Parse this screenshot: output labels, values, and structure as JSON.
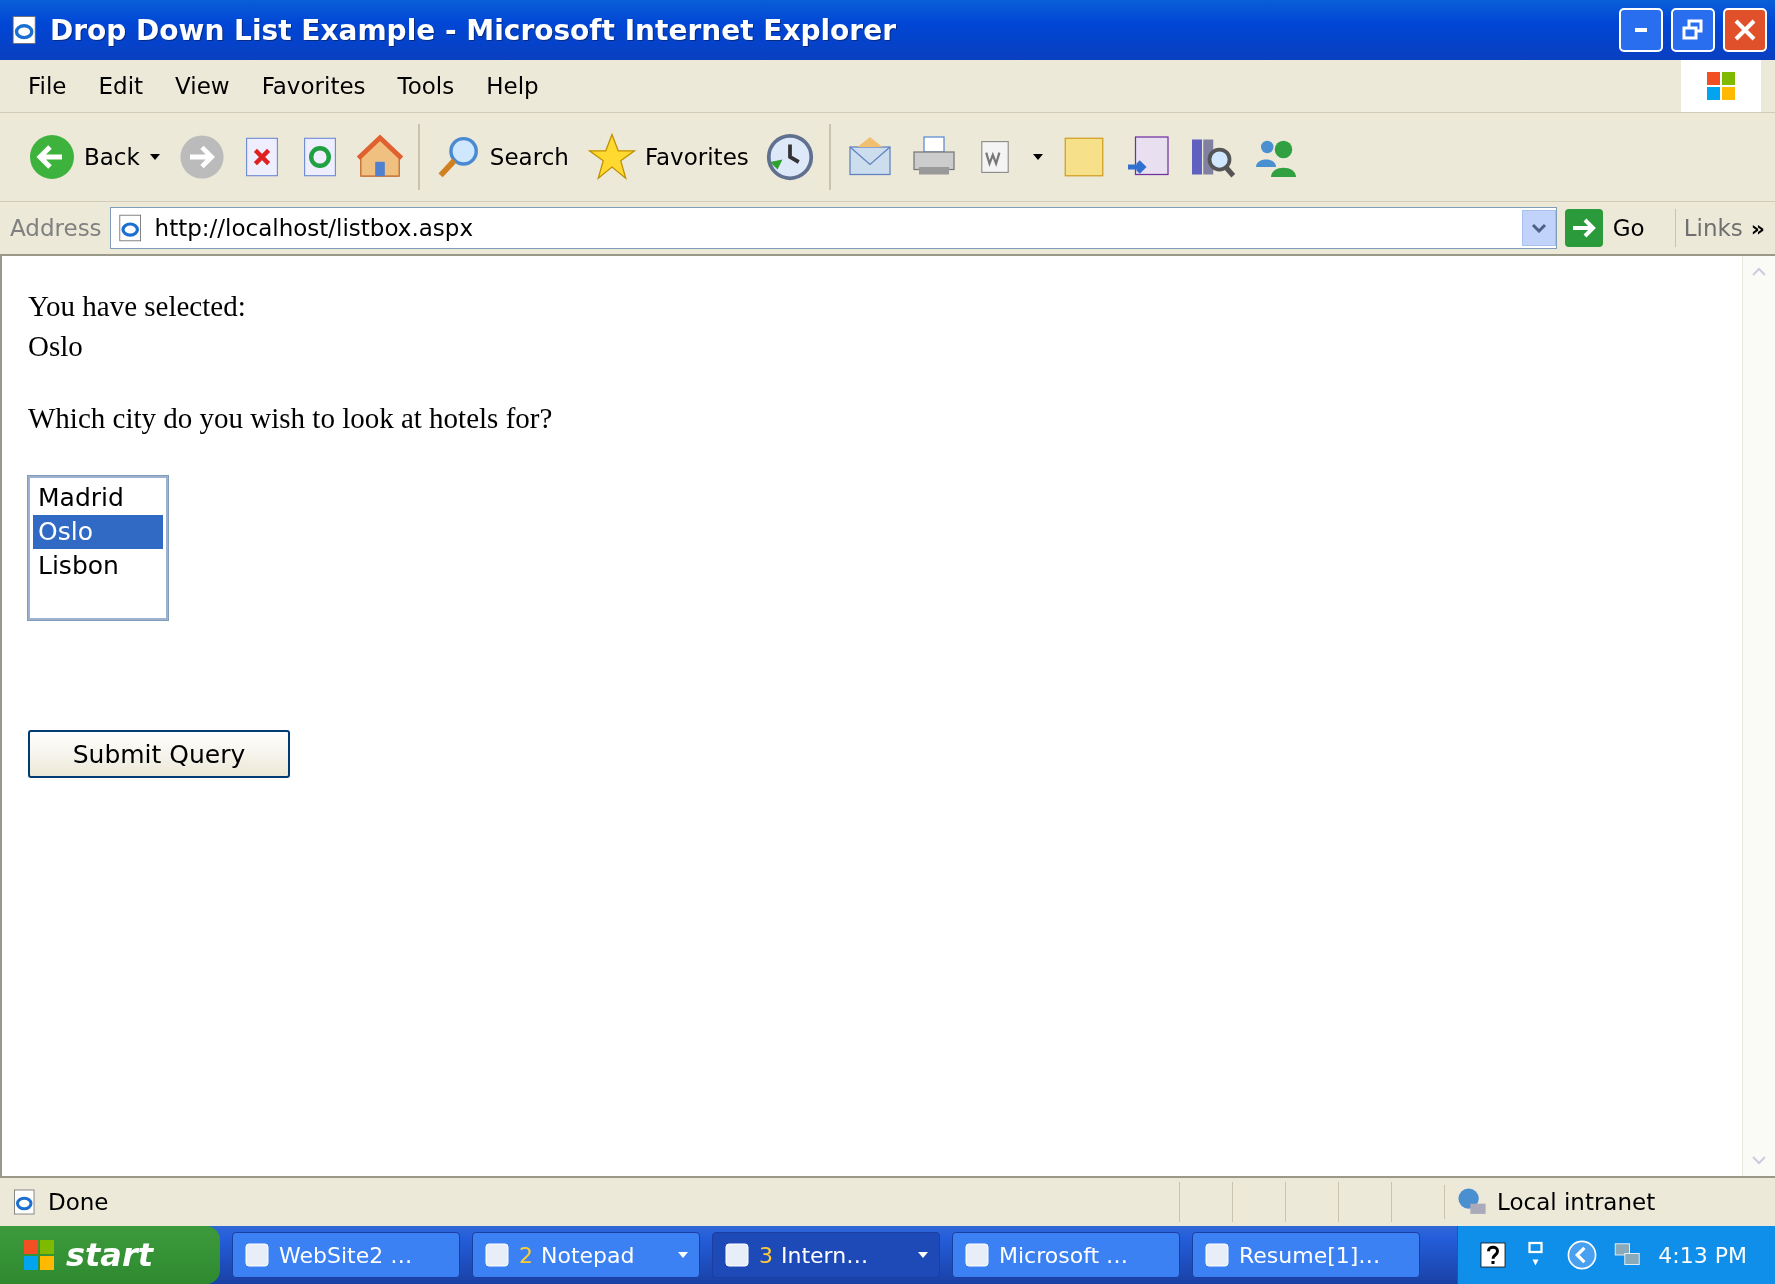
{
  "window": {
    "title": "Drop Down List Example - Microsoft Internet Explorer"
  },
  "menu": [
    "File",
    "Edit",
    "View",
    "Favorites",
    "Tools",
    "Help"
  ],
  "toolbar": {
    "back": "Back",
    "search": "Search",
    "favorites": "Favorites"
  },
  "address": {
    "label": "Address",
    "value": "http://localhost/listbox.aspx",
    "go": "Go",
    "links": "Links",
    "more": "»"
  },
  "page": {
    "selected_label": "You have selected:",
    "selected_value": "Oslo",
    "question": "Which city do you wish to look at hotels for?",
    "cities": [
      {
        "label": "Madrid",
        "selected": false
      },
      {
        "label": "Oslo",
        "selected": true
      },
      {
        "label": "Lisbon",
        "selected": false
      }
    ],
    "submit": "Submit Query"
  },
  "status_bar": {
    "text": "Done",
    "zone": "Local intranet"
  },
  "taskbar": {
    "start": "start",
    "clock": "4:13 PM",
    "tasks": [
      {
        "label": "WebSite2 …",
        "group": false,
        "selected": false
      },
      {
        "count": "2",
        "label": "Notepad",
        "group": true,
        "selected": false
      },
      {
        "count": "3",
        "label": "Intern…",
        "group": true,
        "selected": true
      },
      {
        "label": "Microsoft …",
        "group": false,
        "selected": false
      },
      {
        "label": "Resume[1]…",
        "group": false,
        "selected": false
      }
    ]
  }
}
